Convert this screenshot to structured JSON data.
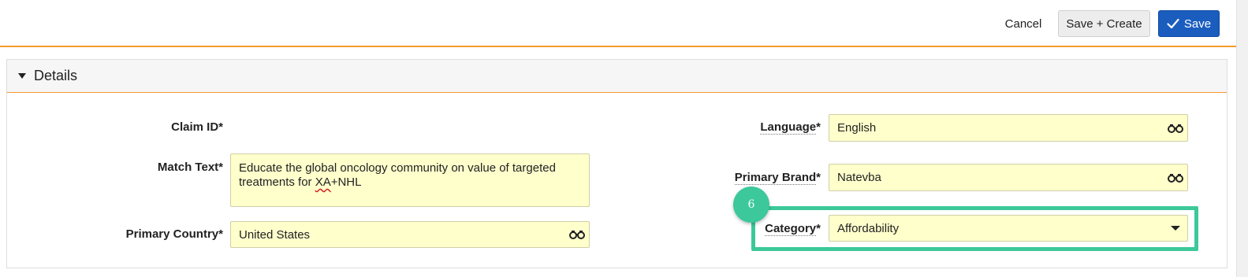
{
  "toolbar": {
    "cancel_label": "Cancel",
    "save_create_label": "Save + Create",
    "save_label": "Save"
  },
  "section": {
    "title": "Details",
    "expanded": true
  },
  "form": {
    "claim_id": {
      "label": "Claim ID",
      "required": "*",
      "value": ""
    },
    "match_text": {
      "label": "Match Text",
      "required": "*",
      "value_line1": "Educate the global oncology community on value of targeted",
      "value_line2_pre": "treatments for ",
      "value_line2_misspelled": "XA",
      "value_line2_post": "+NHL"
    },
    "primary_country": {
      "label": "Primary Country",
      "required": "*",
      "value": "United States",
      "icon": "binoculars-icon"
    },
    "language": {
      "label": "Language",
      "required": "*",
      "value": "English",
      "icon": "binoculars-icon"
    },
    "primary_brand": {
      "label": "Primary Brand",
      "required": "*",
      "value": "Natevba",
      "icon": "binoculars-icon"
    },
    "category": {
      "label": "Category",
      "required": "*",
      "value": "Affordability",
      "icon": "caret-down-icon"
    }
  },
  "annotation": {
    "step_number": "6",
    "color": "#3cc89a"
  },
  "colors": {
    "accent_orange": "#f39a2f",
    "primary_blue": "#1a5dbf",
    "field_yellow": "#ffffcc"
  }
}
